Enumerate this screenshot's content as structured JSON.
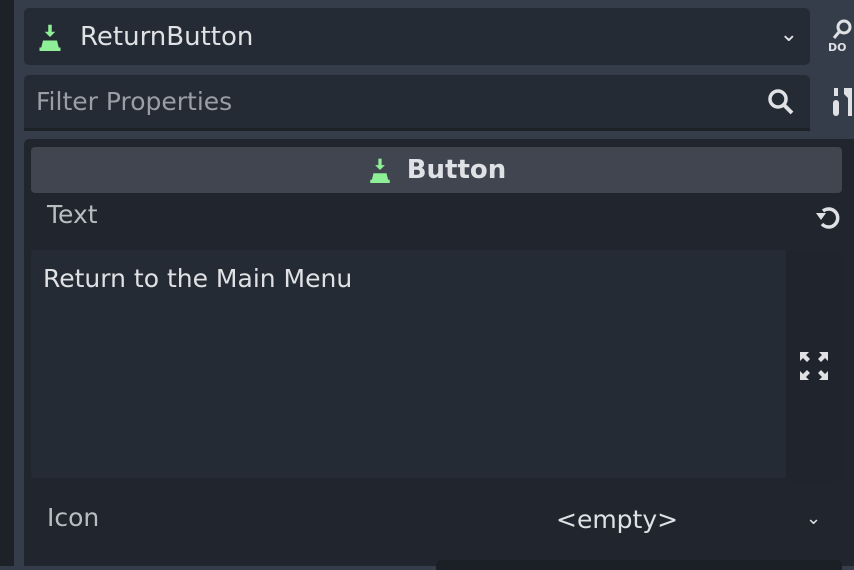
{
  "node_selector": {
    "name": "ReturnButton"
  },
  "filter": {
    "placeholder": "Filter Properties"
  },
  "class_header": {
    "label": "Button"
  },
  "properties": {
    "text": {
      "label": "Text",
      "value": "Return to the Main Menu"
    },
    "icon": {
      "label": "Icon",
      "value": "<empty>"
    }
  },
  "colors": {
    "accent_green": "#8eef97",
    "background": "#363d4a",
    "panel": "#21262e"
  }
}
